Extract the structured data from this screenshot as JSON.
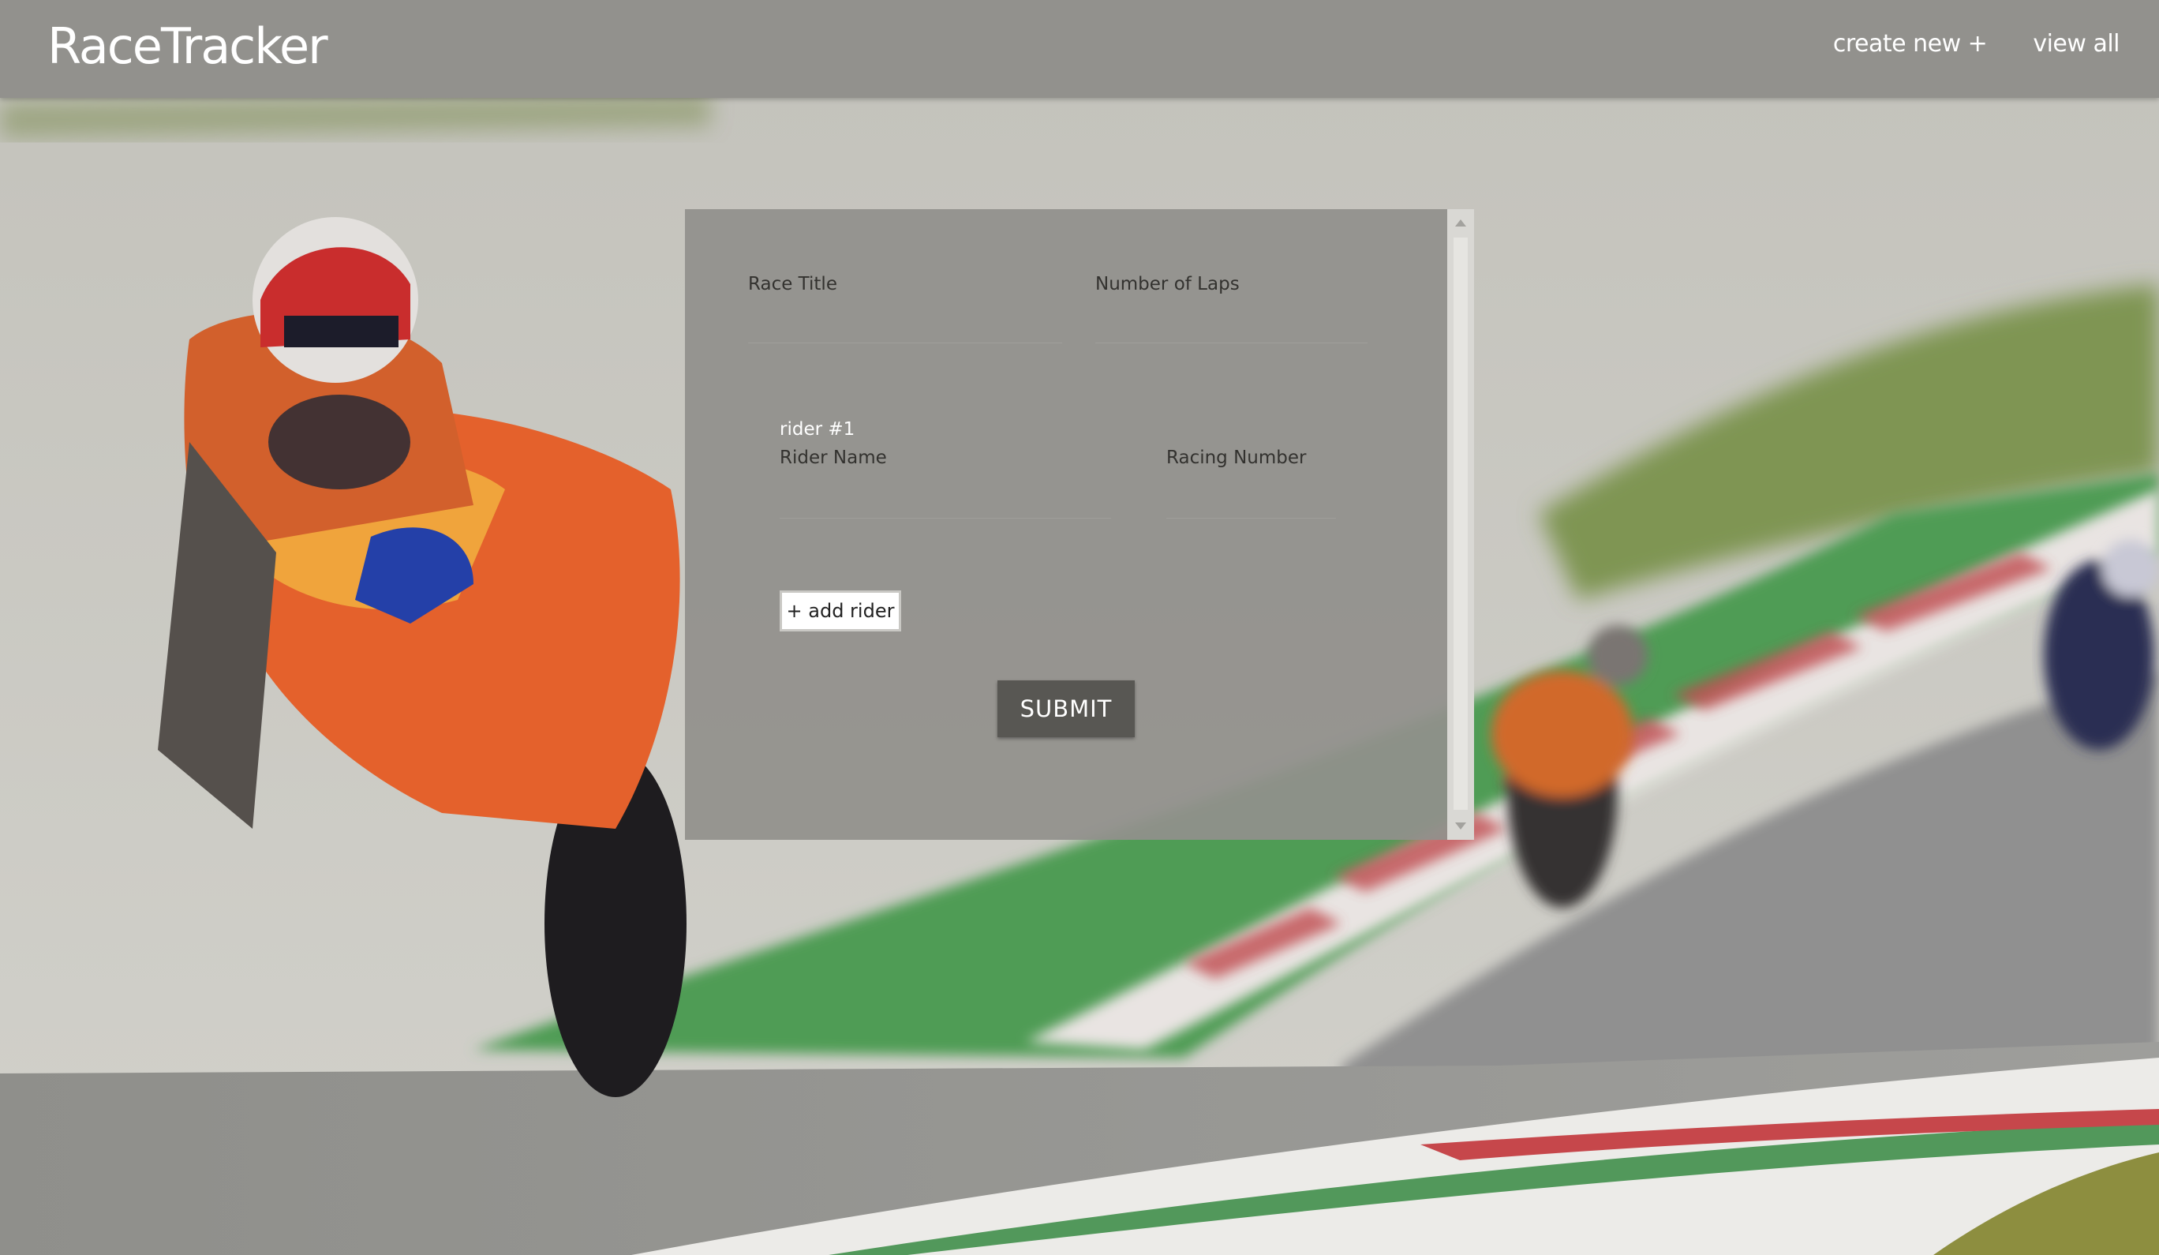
{
  "app": {
    "brand": "RaceTracker"
  },
  "nav": {
    "create_new": "create new +",
    "view_all": "view all"
  },
  "form": {
    "race_title_label": "Race Title",
    "race_title_value": "",
    "laps_label": "Number of Laps",
    "laps_value": "",
    "riders": [
      {
        "heading": "rider #1",
        "name_label": "Rider Name",
        "name_value": "",
        "number_label": "Racing Number",
        "number_value": ""
      }
    ],
    "add_rider_label": "+ add rider",
    "submit_label": "SUBMIT"
  },
  "colors": {
    "navbar": "#92918d",
    "panel": "#91908c",
    "submit_button": "#585753"
  }
}
